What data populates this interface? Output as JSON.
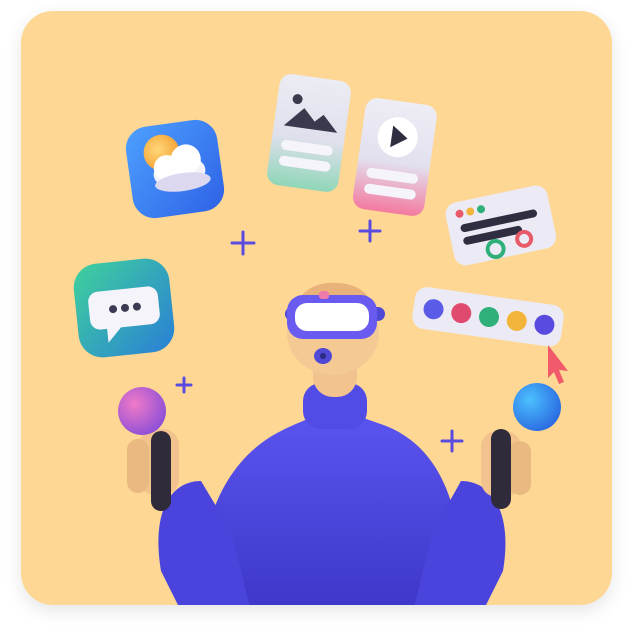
{
  "scene": {
    "background_color": "#FDD793",
    "subject": "person-wearing-vr-headset",
    "accent_colors": {
      "sweater": "#4B45E0",
      "headset": "#6A5BF0",
      "weather_app": "#2E7BF0",
      "chat_app": "#2FB58A",
      "controller_left": "#C85AD8",
      "controller_right": "#2F8FF0"
    },
    "floating_items": [
      {
        "name": "weather-app-icon",
        "icon": "cloud-sun"
      },
      {
        "name": "chat-app-icon",
        "icon": "speech-bubble"
      },
      {
        "name": "image-card",
        "icon": "mountain-image"
      },
      {
        "name": "video-card",
        "icon": "play"
      },
      {
        "name": "text-card",
        "icon": "document-lines"
      },
      {
        "name": "color-palette-bar",
        "icon": "color-dots-with-cursor"
      }
    ],
    "palette_dots": [
      "#5A5BE6",
      "#E04A6E",
      "#2FB07A",
      "#F2B43A",
      "#5A4BE0"
    ],
    "text_card_dots": [
      "#E85A6A",
      "#F2B43A",
      "#2FB07A"
    ]
  }
}
